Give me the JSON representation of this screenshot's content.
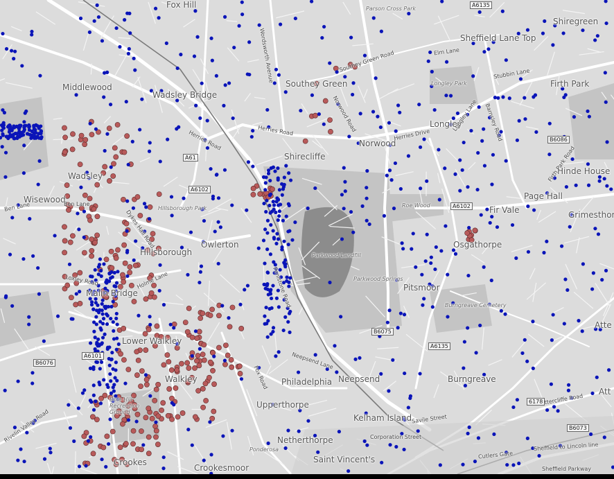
{
  "places": [
    {
      "id": "fox-hill",
      "text": "Fox Hill",
      "cls": "big"
    },
    {
      "id": "parson-cross-park",
      "text": "Parson Cross Park",
      "cls": "ital"
    },
    {
      "id": "shiregreen",
      "text": "Shiregreen",
      "cls": "big"
    },
    {
      "id": "sheffield-lane-top",
      "text": "Sheffield Lane Top",
      "cls": "big"
    },
    {
      "id": "middlewood",
      "text": "Middlewood",
      "cls": "big"
    },
    {
      "id": "wadsley-bridge",
      "text": "Wadsley Bridge",
      "cls": "big"
    },
    {
      "id": "southey-green",
      "text": "Southey Green",
      "cls": "big"
    },
    {
      "id": "longley-park",
      "text": "Longley Park",
      "cls": "ital"
    },
    {
      "id": "firth-park",
      "text": "Firth Park",
      "cls": "big"
    },
    {
      "id": "longley",
      "text": "Longley",
      "cls": "big"
    },
    {
      "id": "norwood",
      "text": "Norwood",
      "cls": "big"
    },
    {
      "id": "shirecliffe",
      "text": "Shirecliffe",
      "cls": "big"
    },
    {
      "id": "wadsley",
      "text": "Wadsley",
      "cls": "big"
    },
    {
      "id": "hinde-house",
      "text": "Hinde House",
      "cls": "big"
    },
    {
      "id": "wisewood",
      "text": "Wisewood",
      "cls": "big"
    },
    {
      "id": "hillsborough-park",
      "text": "Hillsborough Park",
      "cls": "ital"
    },
    {
      "id": "page-hall",
      "text": "Page Hall",
      "cls": "big"
    },
    {
      "id": "fir-vale",
      "text": "Fir Vale",
      "cls": "big"
    },
    {
      "id": "grimesthorpe",
      "text": "Grimesthorpe",
      "cls": "big"
    },
    {
      "id": "roe-wood",
      "text": "Roe Wood",
      "cls": "ital"
    },
    {
      "id": "owlerton",
      "text": "Owlerton",
      "cls": "big"
    },
    {
      "id": "hillsborough",
      "text": "Hillsborough",
      "cls": "big"
    },
    {
      "id": "osgathorpe",
      "text": "Osgathorpe",
      "cls": "big"
    },
    {
      "id": "parkwood-landfill",
      "text": "Parkwood Landfill",
      "cls": "ital"
    },
    {
      "id": "parkwood-springs",
      "text": "Parkwood Springs",
      "cls": "ital"
    },
    {
      "id": "pitsmoor",
      "text": "Pitsmoor",
      "cls": "big"
    },
    {
      "id": "malin-bridge",
      "text": "Malin Bridge",
      "cls": "big"
    },
    {
      "id": "burngreave-cemetery",
      "text": "Burngreave Cemetery",
      "cls": "ital"
    },
    {
      "id": "attercliffe",
      "text": "Atte",
      "cls": "big"
    },
    {
      "id": "lower-walkley",
      "text": "Lower Walkley",
      "cls": "big"
    },
    {
      "id": "walkley",
      "text": "Walkley",
      "cls": "big"
    },
    {
      "id": "philadelphia",
      "text": "Philadelphia",
      "cls": "big"
    },
    {
      "id": "neepsend",
      "text": "Neepsend",
      "cls": "big"
    },
    {
      "id": "burngreave",
      "text": "Burngreave",
      "cls": "big"
    },
    {
      "id": "bole-hill",
      "text": "Bole Hill Recreation Ground",
      "cls": "ital"
    },
    {
      "id": "upperthorpe",
      "text": "Upperthorpe",
      "cls": "big"
    },
    {
      "id": "kelham-island",
      "text": "Kelham Island",
      "cls": "big"
    },
    {
      "id": "netherthorpe",
      "text": "Netherthorpe",
      "cls": "big"
    },
    {
      "id": "ponderosa",
      "text": "Ponderosa",
      "cls": "ital"
    },
    {
      "id": "crookes",
      "text": "Crookes",
      "cls": "big"
    },
    {
      "id": "crookesmoor",
      "text": "Crookesmoor",
      "cls": "big"
    },
    {
      "id": "saint-vincents",
      "text": "Saint Vincent's",
      "cls": "big"
    },
    {
      "id": "attercliffe-2",
      "text": "Att",
      "cls": "big"
    }
  ],
  "road_labels": [
    {
      "id": "wordsworth-avenue",
      "text": "Wordsworth Avenue"
    },
    {
      "id": "southey-green-road",
      "text": "Southey Green Road"
    },
    {
      "id": "elm-lane",
      "text": "Elm Lane"
    },
    {
      "id": "stubbin-lane",
      "text": "Stubbin Lane"
    },
    {
      "id": "herries-road",
      "text": "Herries Road"
    },
    {
      "id": "herries-road-2",
      "text": "Herries Road"
    },
    {
      "id": "norwood-road",
      "text": "Norwood Road"
    },
    {
      "id": "herries-drive",
      "text": "Herries Drive"
    },
    {
      "id": "longley-lane",
      "text": "Longley Lane"
    },
    {
      "id": "barnsley-road",
      "text": "Barnsley Road"
    },
    {
      "id": "firth-park-road",
      "text": "Firth Park Road"
    },
    {
      "id": "ben-lane",
      "text": "Ben Lane"
    },
    {
      "id": "ben-lane-2",
      "text": "Ben Lane"
    },
    {
      "id": "dykes-hall-road",
      "text": "Dykes Hall Road"
    },
    {
      "id": "loxley-road",
      "text": "Loxley Road"
    },
    {
      "id": "holme-lane",
      "text": "Holme Lane"
    },
    {
      "id": "penistone-road",
      "text": "Penistone Road"
    },
    {
      "id": "rivelin-valley-road",
      "text": "Rivelin Valley Road"
    },
    {
      "id": "neepsend-lane",
      "text": "Neepsend Lane"
    },
    {
      "id": "fox-road",
      "text": "Fox Road"
    },
    {
      "id": "corporation-street",
      "text": "Corporation Street"
    },
    {
      "id": "savile-street",
      "text": "Savile Street"
    },
    {
      "id": "sheffield-to-lincoln",
      "text": "Sheffield to Lincoln line"
    },
    {
      "id": "sheffield-parkway",
      "text": "Sheffield Parkway"
    },
    {
      "id": "attercliffe-road",
      "text": "Attercliffe Road"
    },
    {
      "id": "cutlers-gate",
      "text": "Cutlers Gate"
    }
  ],
  "shields": [
    {
      "id": "a6135-top",
      "text": "A6135"
    },
    {
      "id": "a61",
      "text": "A61"
    },
    {
      "id": "a6102-west",
      "text": "A6102"
    },
    {
      "id": "b6086",
      "text": "B6086"
    },
    {
      "id": "a6102-east",
      "text": "A6102"
    },
    {
      "id": "b6075",
      "text": "B6075"
    },
    {
      "id": "a6135-mid",
      "text": "A6135"
    },
    {
      "id": "a6101",
      "text": "A6101"
    },
    {
      "id": "b6076",
      "text": "B6076"
    },
    {
      "id": "b6073",
      "text": "B6073"
    },
    {
      "id": "a6178",
      "text": "6178"
    }
  ],
  "colors": {
    "background": "#dcdcdc",
    "road": "#ffffff",
    "water": "#8c8c8c",
    "park": "#c6c6c6",
    "blue_dot": "#0a14b8",
    "red_dot": "#b85a5a"
  }
}
